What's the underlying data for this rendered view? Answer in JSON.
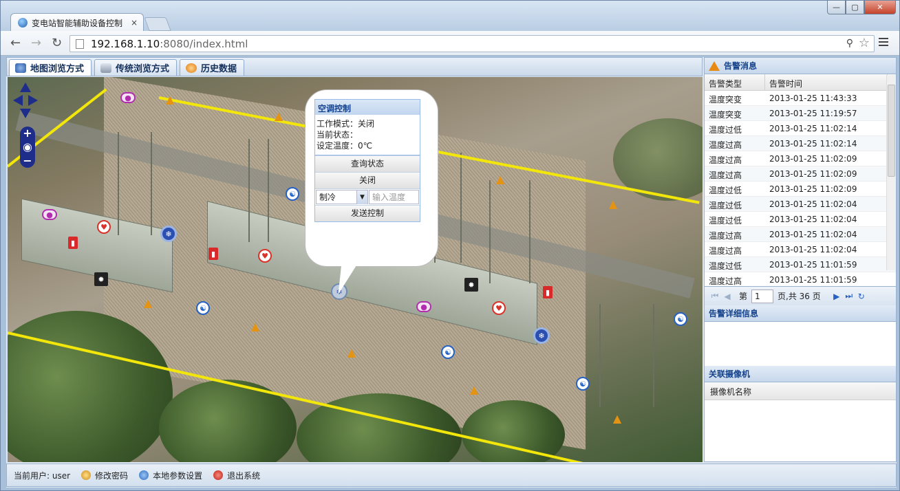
{
  "browser": {
    "tab_title": "变电站智能辅助设备控制",
    "tab_close": "×",
    "url_host": "192.168.1.10",
    "url_path": ":8080/index.html",
    "window_buttons": [
      "—",
      "▢",
      "✕"
    ]
  },
  "app_tabs": [
    {
      "label": "地图浏览方式",
      "icon": "globe-icon"
    },
    {
      "label": "传统浏览方式",
      "icon": "computer-icon"
    },
    {
      "label": "历史数据",
      "icon": "history-icon"
    }
  ],
  "popup": {
    "title": "空调控制",
    "mode_line": "工作模式：关闭",
    "state_line": "当前状态：",
    "temp_line": "设定温度：0℃",
    "query_button": "查询状态",
    "close_button": "关闭",
    "mode_select": "制冷",
    "temp_placeholder": "输入温度",
    "send_button": "发送控制"
  },
  "alarm_panel": {
    "title": "告警消息",
    "col_type": "告警类型",
    "col_time": "告警时间",
    "rows": [
      {
        "type": "温度突变",
        "time": "2013-01-25 11:43:33"
      },
      {
        "type": "温度突变",
        "time": "2013-01-25 11:19:57"
      },
      {
        "type": "温度过低",
        "time": "2013-01-25 11:02:14"
      },
      {
        "type": "温度过高",
        "time": "2013-01-25 11:02:14"
      },
      {
        "type": "温度过高",
        "time": "2013-01-25 11:02:09"
      },
      {
        "type": "温度过高",
        "time": "2013-01-25 11:02:09"
      },
      {
        "type": "温度过低",
        "time": "2013-01-25 11:02:09"
      },
      {
        "type": "温度过低",
        "time": "2013-01-25 11:02:04"
      },
      {
        "type": "温度过低",
        "time": "2013-01-25 11:02:04"
      },
      {
        "type": "温度过高",
        "time": "2013-01-25 11:02:04"
      },
      {
        "type": "温度过高",
        "time": "2013-01-25 11:02:04"
      },
      {
        "type": "温度过低",
        "time": "2013-01-25 11:01:59"
      },
      {
        "type": "温度过高",
        "time": "2013-01-25 11:01:59"
      }
    ],
    "pager": {
      "page_prefix": "第",
      "page_value": "1",
      "page_suffix": "页,共 36 页"
    }
  },
  "detail_panel": {
    "title": "告警详细信息"
  },
  "camera_panel": {
    "title": "关联摄像机",
    "col_name": "摄像机名称"
  },
  "footer": {
    "user_label": "当前用户: user",
    "change_password": "修改密码",
    "local_settings": "本地参数设置",
    "logout": "退出系统"
  }
}
